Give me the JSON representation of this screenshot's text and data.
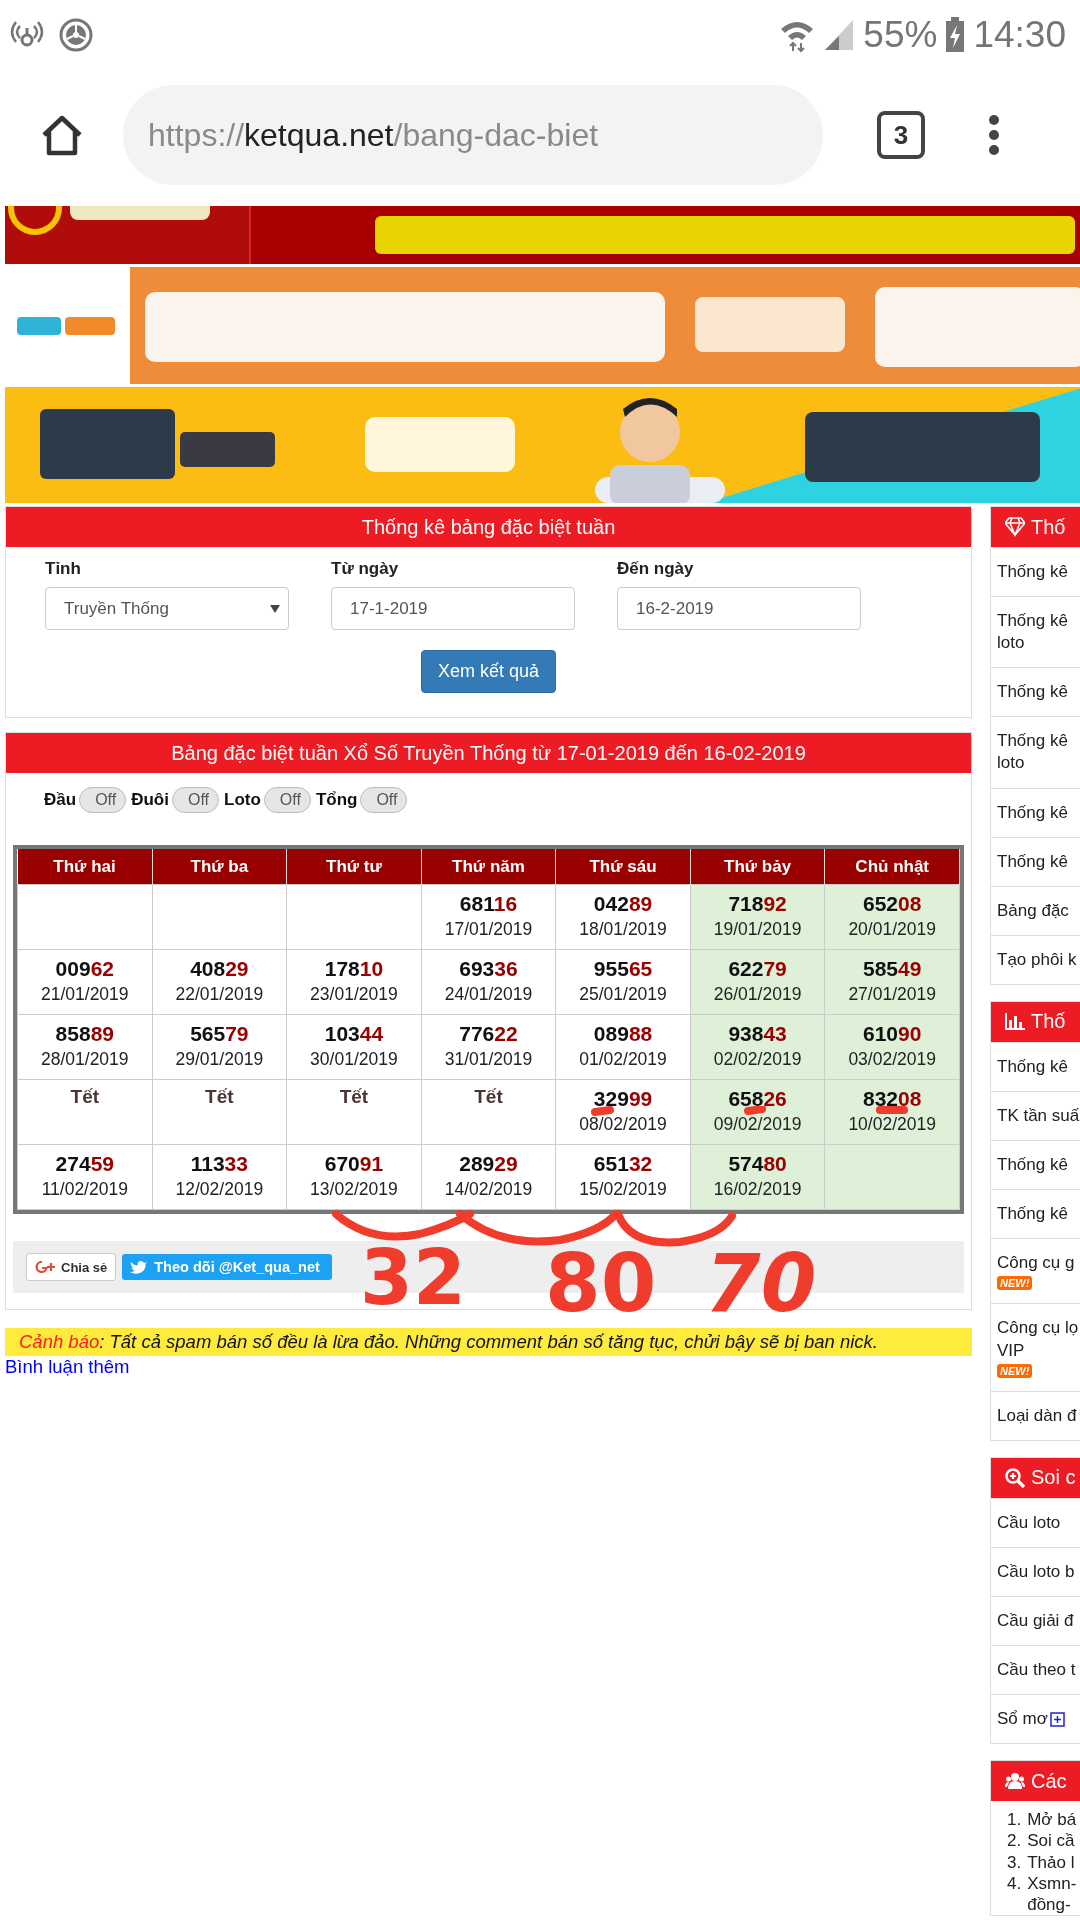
{
  "status_bar": {
    "battery": "55%",
    "time": "14:30"
  },
  "browser": {
    "url": {
      "scheme": "https://",
      "host": "ketqua.net",
      "path": "/bang-dac-biet"
    },
    "tab_count": "3"
  },
  "banners": [
    {
      "kind": "picture"
    },
    {
      "kind": "picture"
    },
    {
      "kind": "picture"
    }
  ],
  "filter_panel": {
    "title": "Thống kê bảng đặc biệt tuần",
    "fields": [
      {
        "kind": "select",
        "label": "Tỉnh",
        "value": "Truyền Thống"
      },
      {
        "kind": "text",
        "label": "Từ ngày",
        "value": "17-1-2019"
      },
      {
        "kind": "text",
        "label": "Đến ngày",
        "value": "16-2-2019"
      }
    ],
    "submit": "Xem kết quả"
  },
  "results_panel": {
    "title": "Bảng đặc biệt tuần Xổ Số Truyền Thống từ 17-01-2019 đến 16-02-2019",
    "toggles": [
      {
        "label": "Đầu",
        "state": "Off",
        "on": false
      },
      {
        "label": "Đuôi",
        "state": "Off",
        "on": false
      },
      {
        "label": "Loto",
        "state": "Off",
        "on": false
      },
      {
        "label": "Tổng",
        "state": "Off",
        "on": false
      }
    ],
    "table": {
      "columns": [
        {
          "label": "Thứ hai",
          "highlighted": false
        },
        {
          "label": "Thứ ba",
          "highlighted": false
        },
        {
          "label": "Thứ tư",
          "highlighted": false
        },
        {
          "label": "Thứ năm",
          "highlighted": false
        },
        {
          "label": "Thứ sáu",
          "highlighted": false
        },
        {
          "label": "Thứ bảy",
          "highlighted": true
        },
        {
          "label": "Chủ nhật",
          "highlighted": true
        }
      ],
      "rows": [
        [
          {
            "kind": "empty"
          },
          {
            "kind": "empty"
          },
          {
            "kind": "empty"
          },
          {
            "kind": "result",
            "head": "681",
            "tail": "16",
            "date": "17/01/2019"
          },
          {
            "kind": "result",
            "head": "042",
            "tail": "89",
            "date": "18/01/2019"
          },
          {
            "kind": "result",
            "head": "718",
            "tail": "92",
            "date": "19/01/2019"
          },
          {
            "kind": "result",
            "head": "652",
            "tail": "08",
            "date": "20/01/2019"
          }
        ],
        [
          {
            "kind": "result",
            "head": "009",
            "tail": "62",
            "date": "21/01/2019"
          },
          {
            "kind": "result",
            "head": "408",
            "tail": "29",
            "date": "22/01/2019"
          },
          {
            "kind": "result",
            "head": "178",
            "tail": "10",
            "date": "23/01/2019"
          },
          {
            "kind": "result",
            "head": "693",
            "tail": "36",
            "date": "24/01/2019"
          },
          {
            "kind": "result",
            "head": "955",
            "tail": "65",
            "date": "25/01/2019"
          },
          {
            "kind": "result",
            "head": "622",
            "tail": "79",
            "date": "26/01/2019"
          },
          {
            "kind": "result",
            "head": "585",
            "tail": "49",
            "date": "27/01/2019"
          }
        ],
        [
          {
            "kind": "result",
            "head": "858",
            "tail": "89",
            "date": "28/01/2019"
          },
          {
            "kind": "result",
            "head": "565",
            "tail": "79",
            "date": "29/01/2019"
          },
          {
            "kind": "result",
            "head": "103",
            "tail": "44",
            "date": "30/01/2019"
          },
          {
            "kind": "result",
            "head": "776",
            "tail": "22",
            "date": "31/01/2019"
          },
          {
            "kind": "result",
            "head": "089",
            "tail": "88",
            "date": "01/02/2019"
          },
          {
            "kind": "result",
            "head": "938",
            "tail": "43",
            "date": "02/02/2019"
          },
          {
            "kind": "result",
            "head": "610",
            "tail": "90",
            "date": "03/02/2019"
          }
        ],
        [
          {
            "kind": "holiday",
            "label": "Tết"
          },
          {
            "kind": "holiday",
            "label": "Tết"
          },
          {
            "kind": "holiday",
            "label": "Tết"
          },
          {
            "kind": "holiday",
            "label": "Tết"
          },
          {
            "kind": "result",
            "head": "329",
            "tail": "99",
            "date": "08/02/2019"
          },
          {
            "kind": "result",
            "head": "658",
            "tail": "26",
            "date": "09/02/2019"
          },
          {
            "kind": "result",
            "head": "832",
            "tail": "08",
            "date": "10/02/2019"
          }
        ],
        [
          {
            "kind": "result",
            "head": "274",
            "tail": "59",
            "date": "11/02/2019"
          },
          {
            "kind": "result",
            "head": "113",
            "tail": "33",
            "date": "12/02/2019"
          },
          {
            "kind": "result",
            "head": "670",
            "tail": "91",
            "date": "13/02/2019"
          },
          {
            "kind": "result",
            "head": "289",
            "tail": "29",
            "date": "14/02/2019"
          },
          {
            "kind": "result",
            "head": "651",
            "tail": "32",
            "date": "15/02/2019"
          },
          {
            "kind": "result",
            "head": "574",
            "tail": "80",
            "date": "16/02/2019"
          },
          {
            "kind": "empty"
          }
        ]
      ]
    },
    "share": {
      "google": "Chia sẻ",
      "twitter": "Theo dõi @Ket_qua_net"
    }
  },
  "handwritten": [
    "32",
    "80",
    "70"
  ],
  "warning": {
    "label": "Cảnh báo",
    "text": ": Tất cả spam bán số đều là lừa đảo. Những comment bán số tăng tục, chửi bậy sẽ bị ban nick."
  },
  "more_comments": "Bình luận thêm",
  "sidebar": [
    {
      "title": "Thố",
      "kind": "links",
      "items": [
        {
          "lines": [
            "Thống kê"
          ]
        },
        {
          "lines": [
            "Thống kê",
            "loto"
          ]
        },
        {
          "lines": [
            "Thống kê"
          ]
        },
        {
          "lines": [
            "Thống kê",
            "loto"
          ]
        },
        {
          "lines": [
            "Thống kê"
          ]
        },
        {
          "lines": [
            "Thống kê"
          ]
        },
        {
          "lines": [
            "Bảng đặc"
          ]
        },
        {
          "lines": [
            "Tạo phôi k"
          ]
        }
      ]
    },
    {
      "title": "Thố",
      "kind": "links",
      "items": [
        {
          "lines": [
            "Thống kê"
          ]
        },
        {
          "lines": [
            "TK tần suấ"
          ]
        },
        {
          "lines": [
            "Thống kê"
          ]
        },
        {
          "lines": [
            "Thống kê"
          ]
        },
        {
          "lines": [
            "Công cụ g"
          ],
          "badge": "NEW!"
        },
        {
          "lines": [
            "Công cụ lọ",
            "VIP"
          ],
          "badge": "NEW!"
        },
        {
          "lines": [
            "Loại dàn đ"
          ]
        }
      ]
    },
    {
      "title": "Soi c",
      "kind": "links",
      "items": [
        {
          "lines": [
            "Cầu loto"
          ]
        },
        {
          "lines": [
            "Cầu loto b"
          ]
        },
        {
          "lines": [
            "Cầu giải đ"
          ]
        },
        {
          "lines": [
            "Cầu theo t"
          ]
        },
        {
          "lines": [
            "Sổ mơ"
          ],
          "expandable": true
        }
      ]
    },
    {
      "title": "Các",
      "kind": "numbered",
      "items": [
        {
          "number": "1.",
          "lines": [
            "Mở bá"
          ]
        },
        {
          "number": "2.",
          "lines": [
            "Soi cầ"
          ]
        },
        {
          "number": "3.",
          "lines": [
            "Thảo l"
          ]
        },
        {
          "number": "4.",
          "lines": [
            "Xsmn-",
            "đồng-"
          ]
        }
      ]
    }
  ]
}
